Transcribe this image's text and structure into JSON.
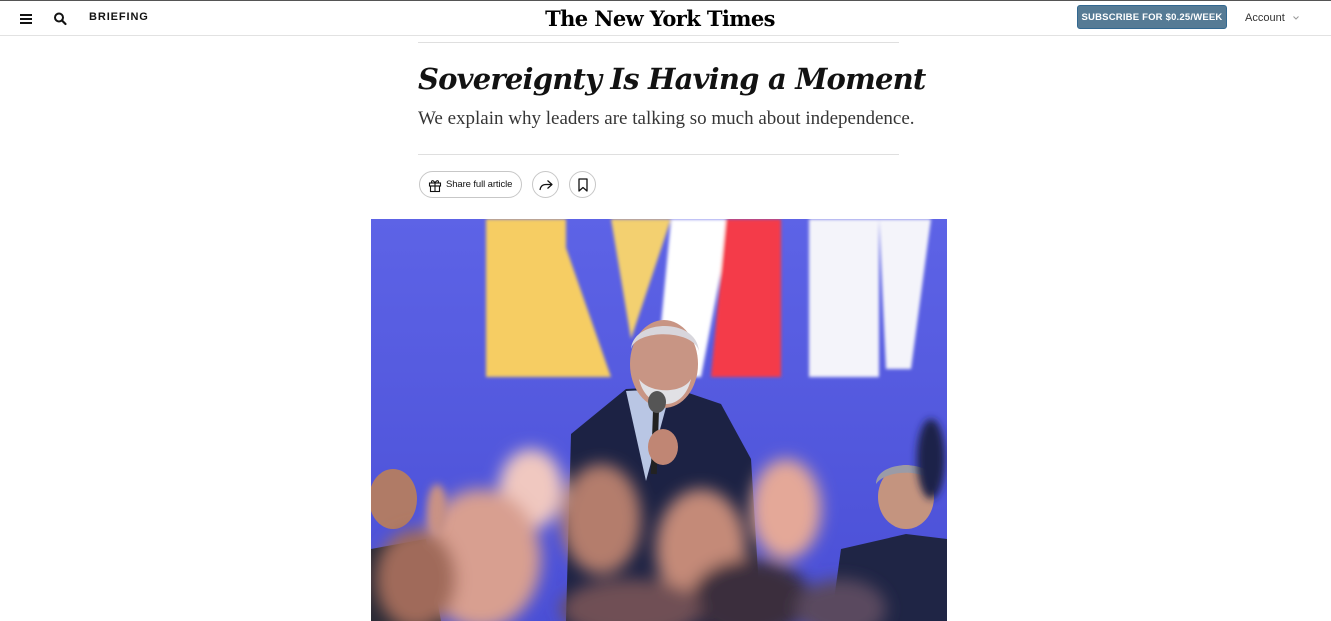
{
  "header": {
    "menu_icon": "hamburger-menu-icon",
    "search_icon": "search-icon",
    "section": "BRIEFING",
    "logo": "The New York Times",
    "subscribe_label": "SUBSCRIBE FOR $0.25/WEEK",
    "account_label": "Account",
    "accent_color": "#567b95"
  },
  "article": {
    "headline": "Sovereignty Is Having a Moment",
    "summary": "We explain why leaders are talking so much about independence.",
    "share_full_label": "Share full article",
    "share_icon": "share-arrow-icon",
    "save_icon": "bookmark-icon",
    "gift_icon": "gift-icon"
  },
  "image": {
    "description_icon": "speaker-photo"
  }
}
